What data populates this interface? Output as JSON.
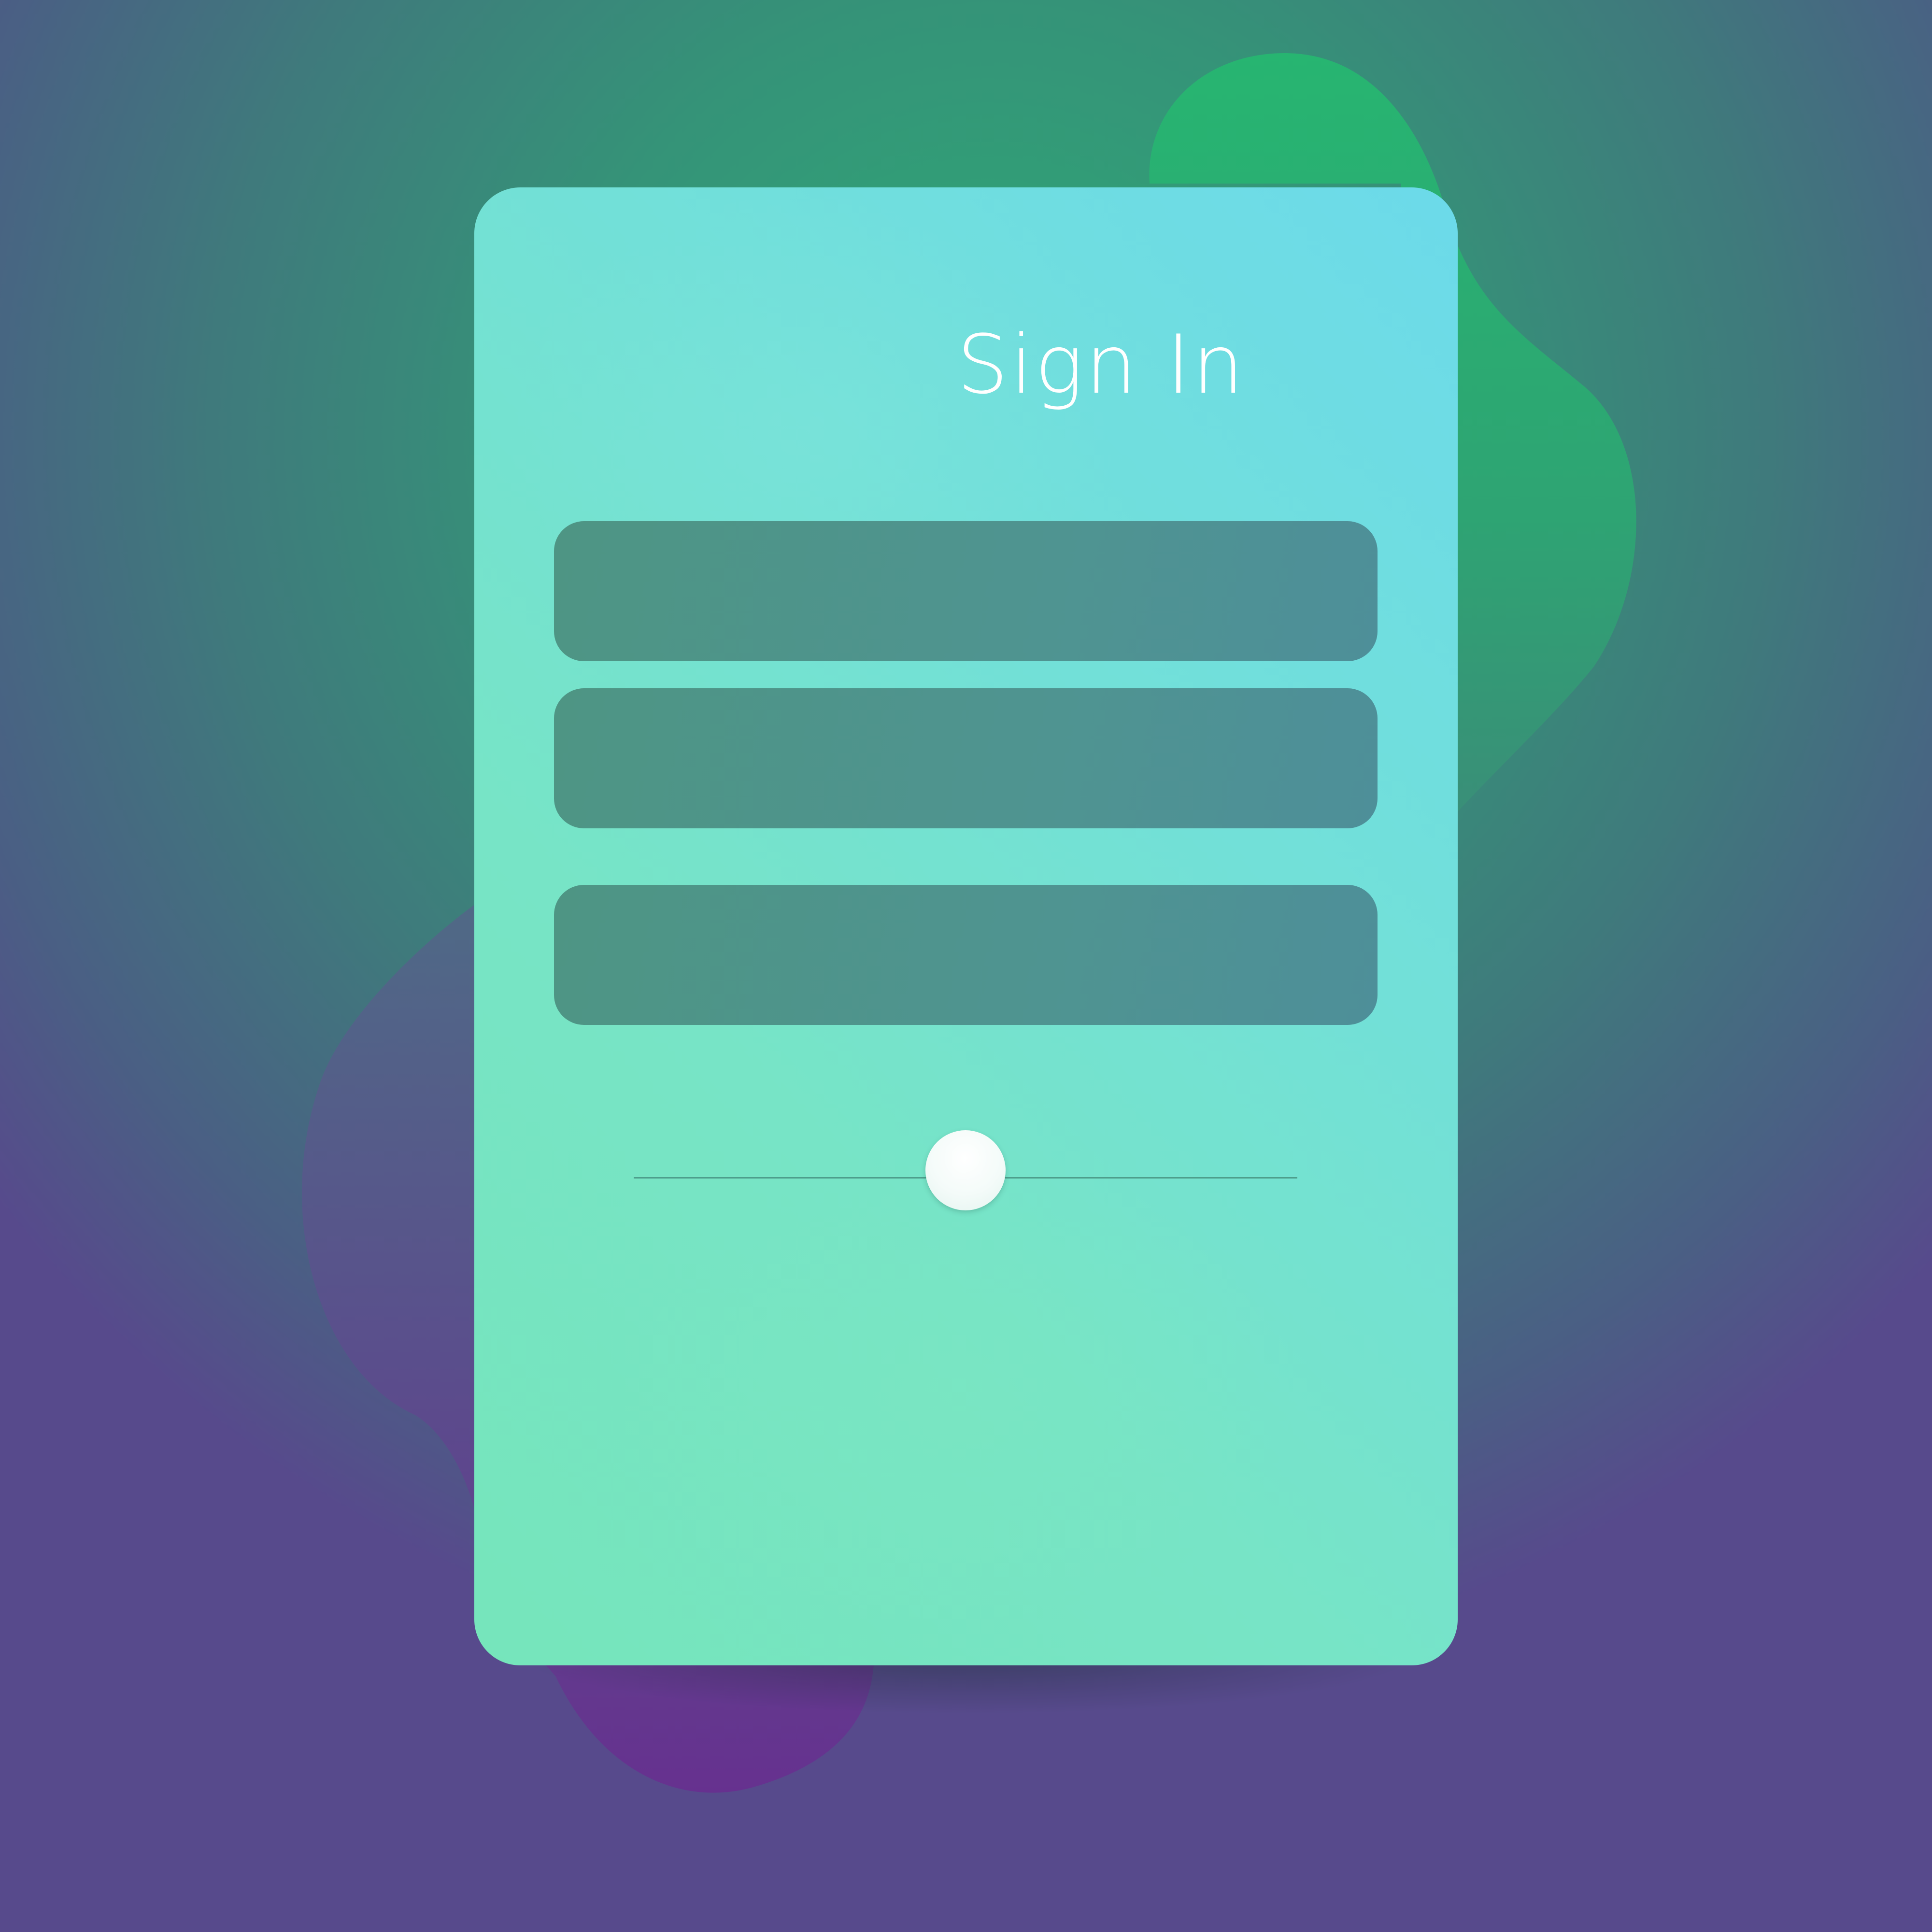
{
  "page": {
    "title": "Sign In"
  },
  "form": {
    "fields": [
      {
        "name": "field-1",
        "value": "",
        "placeholder": ""
      },
      {
        "name": "field-2",
        "value": "",
        "placeholder": ""
      },
      {
        "name": "field-3",
        "value": "",
        "placeholder": ""
      }
    ],
    "slider": {
      "value": 0.5
    }
  },
  "colors": {
    "background_top": "#2eaa76",
    "background_bottom": "#574a8c",
    "card_top_right": "#6cdaea",
    "card_bottom_left": "#76e5bb",
    "field_fill": "#4e9584",
    "title_text": "#ffffff",
    "blob_green": "#2bb36e",
    "blob_purple": "#63328f"
  }
}
